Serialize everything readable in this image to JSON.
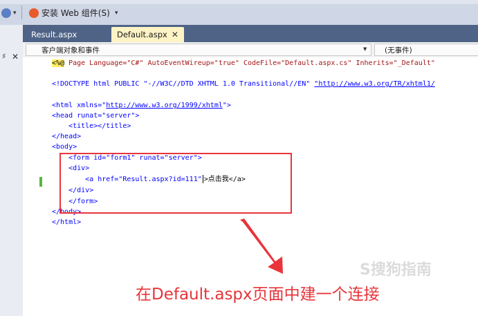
{
  "toolbar": {
    "install_label": "安装 Web 组件(S)"
  },
  "tabs": [
    {
      "label": "Result.aspx",
      "active": false
    },
    {
      "label": "Default.aspx",
      "active": true
    }
  ],
  "navbar": {
    "left": "客户端对象和事件",
    "right": "(无事件)"
  },
  "code": {
    "l1_a": "<%@",
    "l1_b": " Page Language=\"C#\" AutoEventWireup=\"true\" CodeFile=\"Default.aspx.cs\" Inherits=\"_Default\"",
    "l2_a": "<!DOCTYPE html PUBLIC \"-//W3C//DTD XHTML 1.0 Transitional//EN\" ",
    "l2_b": "\"http://www.w3.org/TR/xhtml1/",
    "l3_a": "<html xmlns=\"",
    "l3_b": "http://www.w3.org/1999/xhtml",
    "l3_c": "\">",
    "l4": "<head runat=\"server\">",
    "l5": "    <title></title>",
    "l6": "</head>",
    "l7": "<body>",
    "l8": "    <form id=\"form1\" runat=\"server\">",
    "l9": "    <div>",
    "l10_a": "        <a href=\"Result.aspx?id=111\"",
    "l10_b": ">点击我</a>",
    "l11": "    </div>",
    "l12": "    </form>",
    "l13": "</body>",
    "l14": "</html>"
  },
  "annotation": {
    "caption": "在Default.aspx页面中建一个连接",
    "color": "#e8343a"
  },
  "watermark": {
    "text": "S搜狗指南"
  }
}
